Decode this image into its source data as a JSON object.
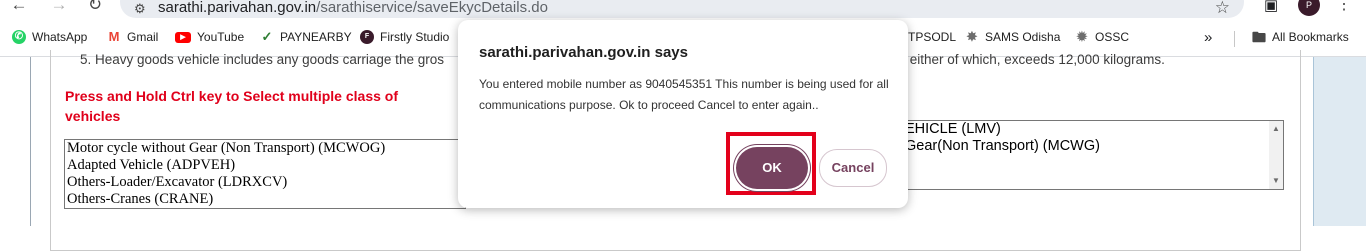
{
  "browser": {
    "url_domain": "sarathi.parivahan.gov.in",
    "url_path": "/sarathiservice/saveEkycDetails.do",
    "profile_initials": "P"
  },
  "bookmarks": {
    "items": [
      {
        "label": "WhatsApp",
        "icon": "whatsapp-icon",
        "color": "#25d366"
      },
      {
        "label": "Gmail",
        "icon": "gmail-icon",
        "color": "#ea4335"
      },
      {
        "label": "YouTube",
        "icon": "youtube-icon",
        "color": "#ff0000"
      },
      {
        "label": "PAYNEARBY",
        "icon": "paynearby-icon",
        "color": "#2e7d32"
      },
      {
        "label": "Firstly Studio",
        "icon": "firstly-studio-icon",
        "color": "#3a1b2b"
      },
      {
        "label": "TPSODL",
        "icon": "tpsodl-icon",
        "color": "#1565c0"
      },
      {
        "label": "SAMS Odisha",
        "icon": "sams-odisha-icon",
        "color": "#6d6d6d"
      },
      {
        "label": "OSSC",
        "icon": "ossc-icon",
        "color": "#6d6d6d"
      }
    ],
    "all_bookmarks": "All Bookmarks"
  },
  "page": {
    "note_left": "5. Heavy goods vehicle includes any goods carriage the gros",
    "note_right": "or either of which, exceeds 12,000 kilograms.",
    "ctrl_hint": "Press and Hold Ctrl key to Select multiple class of vehicles",
    "class_options": [
      "Motor cycle without Gear (Non Transport) (MCWOG)",
      "Adapted Vehicle (ADPVEH)",
      "Others-Loader/Excavator (LDRXCV)",
      "Others-Cranes (CRANE)"
    ],
    "selected_options": [
      "EHICLE (LMV)",
      "Gear(Non Transport) (MCWG)"
    ]
  },
  "dialog": {
    "title": "sarathi.parivahan.gov.in says",
    "message": "You entered mobile number as 9040545351 This number is being used for all communications purpose. Ok to proceed Cancel to enter again..",
    "ok_label": "OK",
    "cancel_label": "Cancel"
  },
  "colors": {
    "accent": "#76425f",
    "highlight": "#e3001b",
    "hint_red": "#e0001b"
  }
}
